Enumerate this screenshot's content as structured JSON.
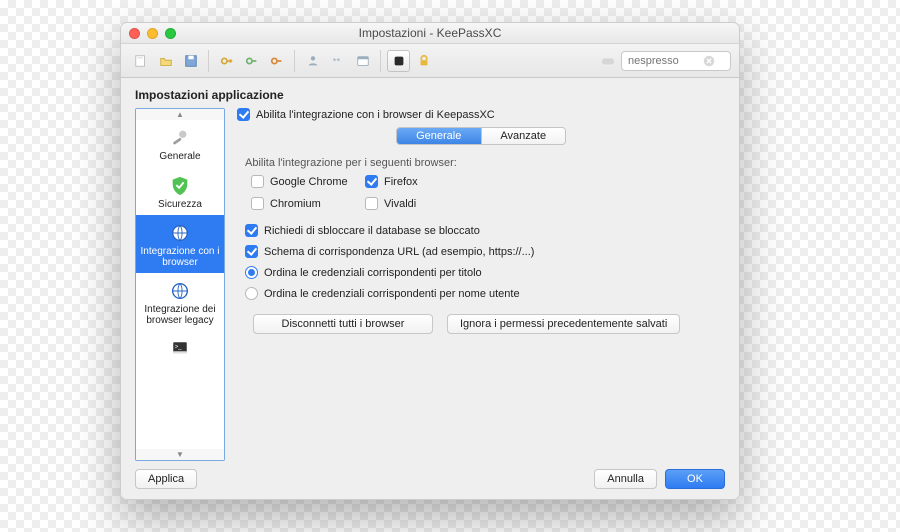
{
  "window": {
    "title": "Impostazioni - KeePassXC"
  },
  "toolbar": {
    "search_placeholder": "nespresso"
  },
  "section_title": "Impostazioni applicazione",
  "sidebar": {
    "items": [
      {
        "label": "Generale"
      },
      {
        "label": "Sicurezza"
      },
      {
        "label": "Integrazione con i browser"
      },
      {
        "label": "Integrazione dei browser legacy"
      },
      {
        "label": ""
      }
    ],
    "selected_index": 2
  },
  "panel": {
    "enable_label": "Abilita l'integrazione con i browser di KeepassXC",
    "tabs": {
      "generale": "Generale",
      "avanzate": "Avanzate"
    },
    "browsers_group_label": "Abilita l'integrazione per i seguenti browser:",
    "browsers": {
      "chrome": "Google Chrome",
      "firefox": "Firefox",
      "chromium": "Chromium",
      "vivaldi": "Vivaldi"
    },
    "options": {
      "unlock": "Richiedi di sbloccare il database se bloccato",
      "scheme": "Schema di corrispondenza URL (ad esempio, https://...)",
      "sort_title": "Ordina le credenziali corrispondenti per titolo",
      "sort_user": "Ordina le credenziali corrispondenti per nome utente"
    },
    "buttons": {
      "disconnect": "Disconnetti tutti i browser",
      "forget": "Ignora i permessi precedentemente salvati"
    }
  },
  "footer": {
    "apply": "Applica",
    "cancel": "Annulla",
    "ok": "OK"
  }
}
